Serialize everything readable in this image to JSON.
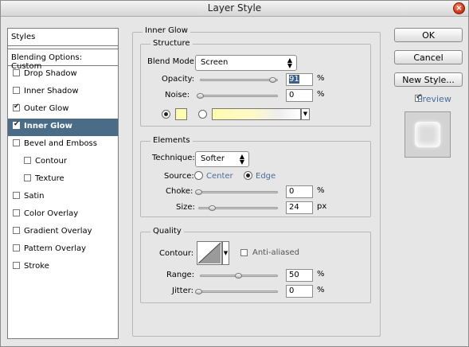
{
  "window": {
    "title": "Layer Style"
  },
  "sidebar": {
    "header": "Styles",
    "blending_options": "Blending Options: Custom",
    "items": [
      {
        "label": "Drop Shadow",
        "checked": false
      },
      {
        "label": "Inner Shadow",
        "checked": false
      },
      {
        "label": "Outer Glow",
        "checked": true
      },
      {
        "label": "Inner Glow",
        "checked": true,
        "selected": true
      },
      {
        "label": "Bevel and Emboss",
        "checked": false
      },
      {
        "label": "Contour",
        "checked": false,
        "indent": true
      },
      {
        "label": "Texture",
        "checked": false,
        "indent": true
      },
      {
        "label": "Satin",
        "checked": false
      },
      {
        "label": "Color Overlay",
        "checked": false
      },
      {
        "label": "Gradient Overlay",
        "checked": false
      },
      {
        "label": "Pattern Overlay",
        "checked": false
      },
      {
        "label": "Stroke",
        "checked": false
      }
    ]
  },
  "panel": {
    "title": "Inner Glow",
    "structure": {
      "title": "Structure",
      "blend_mode_label": "Blend Mode:",
      "blend_mode_value": "Screen",
      "opacity_label": "Opacity:",
      "opacity_value": "91",
      "opacity_unit": "%",
      "noise_label": "Noise:",
      "noise_value": "0",
      "noise_unit": "%",
      "color_hex": "#fffbb0",
      "color_mode": "solid"
    },
    "elements": {
      "title": "Elements",
      "technique_label": "Technique:",
      "technique_value": "Softer",
      "source_label": "Source:",
      "source_center": "Center",
      "source_edge": "Edge",
      "source_selected": "Edge",
      "choke_label": "Choke:",
      "choke_value": "0",
      "choke_unit": "%",
      "size_label": "Size:",
      "size_value": "24",
      "size_unit": "px"
    },
    "quality": {
      "title": "Quality",
      "contour_label": "Contour:",
      "antialiased_label": "Anti-aliased",
      "antialiased_checked": false,
      "range_label": "Range:",
      "range_value": "50",
      "range_unit": "%",
      "jitter_label": "Jitter:",
      "jitter_value": "0",
      "jitter_unit": "%"
    }
  },
  "buttons": {
    "ok": "OK",
    "cancel": "Cancel",
    "new_style": "New Style..."
  },
  "preview": {
    "label": "Preview",
    "checked": true
  },
  "colors": {
    "selected_row": "#4b6c86",
    "glow": "#fffbb0"
  }
}
